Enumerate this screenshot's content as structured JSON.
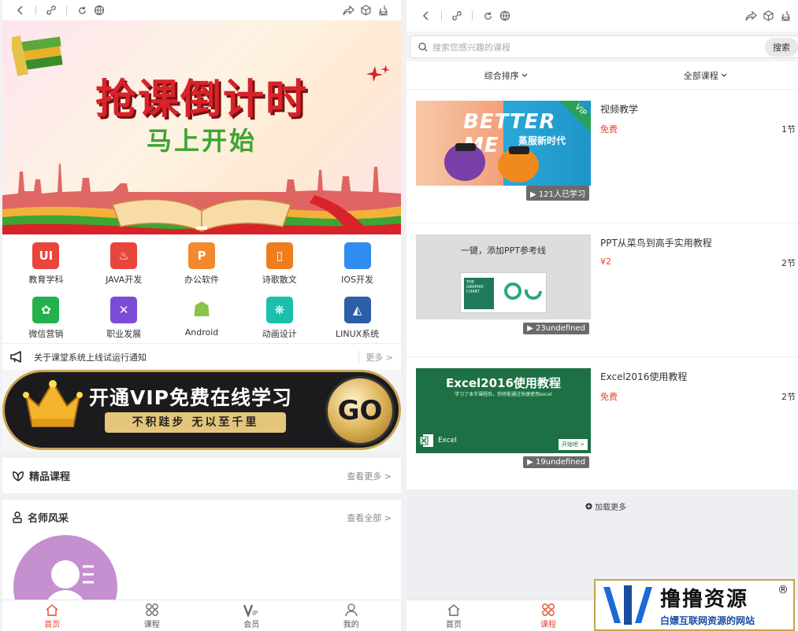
{
  "left": {
    "banner": {
      "title": "抢课倒计时",
      "subtitle": "马上开始"
    },
    "categories": [
      {
        "label": "教育学科",
        "icon": "ui-icon",
        "glyph": "UI",
        "color": "#e8453c"
      },
      {
        "label": "JAVA开发",
        "icon": "java-icon",
        "glyph": "♨",
        "color": "#e8453c"
      },
      {
        "label": "办公软件",
        "icon": "ppt-icon",
        "glyph": "P",
        "color": "#f08a2c"
      },
      {
        "label": "诗歌散文",
        "icon": "phone-icon",
        "glyph": "▯",
        "color": "#f07d1c"
      },
      {
        "label": "IOS开发",
        "icon": "apple-icon",
        "glyph": "",
        "color": "#2f8cf0"
      },
      {
        "label": "微信营销",
        "icon": "palette-icon",
        "glyph": "✿",
        "color": "#23b14d"
      },
      {
        "label": "职业发展",
        "icon": "tools-icon",
        "glyph": "✕",
        "color": "#7b4bd8"
      },
      {
        "label": "Android",
        "icon": "android-icon",
        "glyph": "☗",
        "color": "#ffffff"
      },
      {
        "label": "动画设计",
        "icon": "dots-icon",
        "glyph": "❋",
        "color": "#1cbfae"
      },
      {
        "label": "LINUX系统",
        "icon": "linux-icon",
        "glyph": "◭",
        "color": "#2d5fa8"
      }
    ],
    "notice": {
      "text": "关于课堂系统上线试运行通知",
      "more": "更多 >"
    },
    "vip": {
      "title": "开通VIP免费在线学习",
      "slogan": "不积跬步 无以至千里",
      "go": "GO"
    },
    "featured": {
      "title": "精品课程",
      "more": "查看更多 >"
    },
    "teachers": {
      "title": "名师风采",
      "more": "查看全部 >"
    },
    "tabs": [
      {
        "label": "首页",
        "icon": "home-icon",
        "active": true
      },
      {
        "label": "课程",
        "icon": "course-icon",
        "active": false
      },
      {
        "label": "会员",
        "icon": "vip-icon",
        "active": false
      },
      {
        "label": "我的",
        "icon": "user-icon",
        "active": false
      }
    ]
  },
  "right": {
    "search": {
      "placeholder": "搜索您感兴趣的课程",
      "button": "搜索"
    },
    "sorts": [
      "综合排序",
      "全部课程"
    ],
    "courses": [
      {
        "name": "视频教学",
        "price": "免费",
        "lessons": "1节",
        "learners": "121人已学习",
        "thumb_text": "BETTER ME",
        "thumb_sub": "蒸服新时代",
        "thumb_badge": "VIP"
      },
      {
        "name": "PPT从菜鸟到高手实用教程",
        "price": "¥2",
        "lessons": "2节",
        "learners": "23undefined",
        "thumb_text": "一键，添加PPT参考线",
        "thumb_sub": "THE GRAPHIC CHART"
      },
      {
        "name": "Excel2016使用教程",
        "price": "免费",
        "lessons": "2节",
        "learners": "19undefined",
        "thumb_text": "Excel2016使用教程",
        "thumb_sub": "学习了本节课程后，你将能通过快速使用excel",
        "thumb_brand": "Excel",
        "thumb_button": "开始吧 >"
      }
    ],
    "load_more": "加载更多",
    "tabs": [
      {
        "label": "首页",
        "icon": "home-icon",
        "active": false
      },
      {
        "label": "课程",
        "icon": "course-icon",
        "active": true
      }
    ]
  },
  "watermark": {
    "title": "撸撸资源",
    "subtitle": "白嫖互联网资源的网站",
    "reg": "®"
  },
  "colors": {
    "accent": "#e8452c",
    "vip_gold": "#e5c57c",
    "excel_green": "#1d7044"
  }
}
